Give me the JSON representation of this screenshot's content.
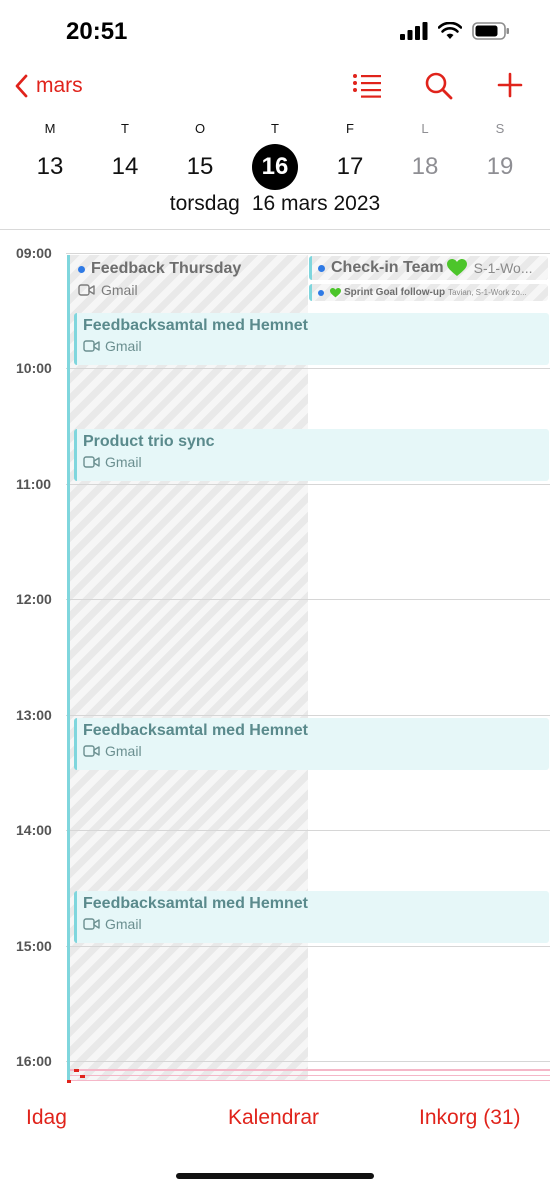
{
  "status_bar": {
    "time": "20:51"
  },
  "nav": {
    "back_label": "mars"
  },
  "week": {
    "days": [
      {
        "letter": "M",
        "number": "13"
      },
      {
        "letter": "T",
        "number": "14"
      },
      {
        "letter": "O",
        "number": "15"
      },
      {
        "letter": "T",
        "number": "16"
      },
      {
        "letter": "F",
        "number": "17"
      },
      {
        "letter": "L",
        "number": "18"
      },
      {
        "letter": "S",
        "number": "19"
      }
    ],
    "selected_weekday": "torsdag",
    "selected_date": "16 mars 2023"
  },
  "timeline": {
    "hours": [
      "09:00",
      "10:00",
      "11:00",
      "12:00",
      "13:00",
      "14:00",
      "15:00",
      "16:00"
    ]
  },
  "events": [
    {
      "title": "Feedback Thursday",
      "calendar": "Gmail"
    },
    {
      "title": "Check-in Team",
      "calendar": "S-1-Wo..."
    },
    {
      "title": "Sprint Goal follow-up",
      "calendar": "Tavian, S-1-Work zo..."
    },
    {
      "title": "Feedbacksamtal med Hemnet",
      "calendar": "Gmail"
    },
    {
      "title": "Product trio sync",
      "calendar": "Gmail"
    },
    {
      "title": "Feedbacksamtal med Hemnet",
      "calendar": "Gmail"
    },
    {
      "title": "Feedbacksamtal med Hemnet",
      "calendar": "Gmail"
    }
  ],
  "tab_bar": {
    "today": "Idag",
    "calendars": "Kalendrar",
    "inbox": "Inkorg (31)"
  },
  "colors": {
    "accent": "#e0231b",
    "event_border": "#7fd6dd",
    "event_bg": "#e6f7f8",
    "dot_blue": "#2f7ae5",
    "heart_green": "#4cc52a"
  },
  "icons": [
    "chevron-left-icon",
    "list-icon",
    "search-icon",
    "plus-icon",
    "video-icon",
    "green-heart-icon",
    "signal-icon",
    "wifi-icon",
    "battery-icon"
  ]
}
